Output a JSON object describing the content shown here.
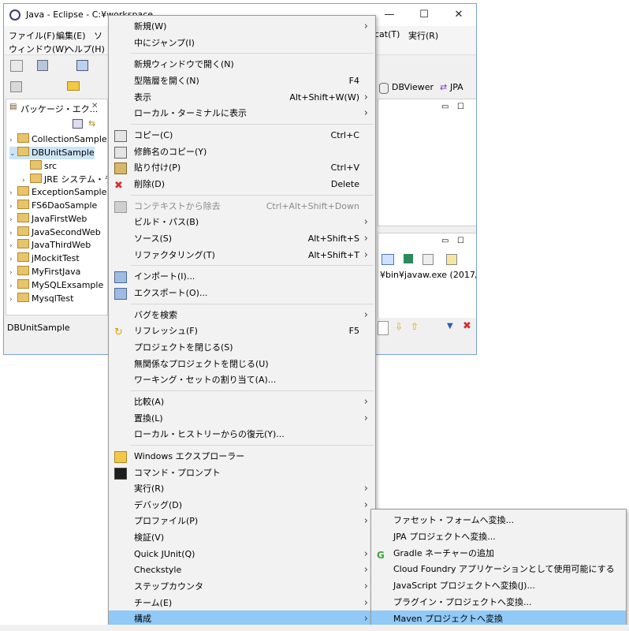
{
  "window": {
    "title": "Java - Eclipse - C:¥workspace",
    "controls": [
      "—",
      "☐",
      "✕"
    ],
    "menubar": [
      "ファイル(F)",
      "編集(E)",
      "ソ",
      "ウィンドウ(W)",
      "ヘルプ(H)",
      "cat(T)",
      "実行(R)"
    ],
    "toolbar_right": [
      "DBViewer",
      "JPA"
    ],
    "explorer_tab": "パッケージ・エク...",
    "tree": [
      {
        "label": "CollectionSample",
        "indent": 0,
        "twisty": ">"
      },
      {
        "label": "DBUnitSample",
        "indent": 0,
        "twisty": "v",
        "selected": true
      },
      {
        "label": "src",
        "indent": 1,
        "twisty": ""
      },
      {
        "label": "JRE システム・ラ",
        "indent": 1,
        "twisty": ">"
      },
      {
        "label": "ExceptionSample",
        "indent": 0,
        "twisty": ">"
      },
      {
        "label": "FS6DaoSample",
        "indent": 0,
        "twisty": ">"
      },
      {
        "label": "JavaFirstWeb",
        "indent": 0,
        "twisty": ">"
      },
      {
        "label": "JavaSecondWeb",
        "indent": 0,
        "twisty": ">"
      },
      {
        "label": "JavaThirdWeb",
        "indent": 0,
        "twisty": ">"
      },
      {
        "label": "jMockitTest",
        "indent": 0,
        "twisty": ">"
      },
      {
        "label": "MyFirstJava",
        "indent": 0,
        "twisty": ">"
      },
      {
        "label": "MySQLExsample",
        "indent": 0,
        "twisty": ">"
      },
      {
        "label": "MysqlTest",
        "indent": 0,
        "twisty": ">"
      }
    ],
    "console_path": "¥bin¥javaw.exe (2017/07/",
    "status_text": "DBUnitSample"
  },
  "context_menu": {
    "items": [
      {
        "label": "新規(W)",
        "shortcut": "",
        "submenu": true,
        "icon": ""
      },
      {
        "label": "中にジャンプ(I)",
        "shortcut": "",
        "submenu": false,
        "icon": ""
      },
      {
        "sep": true
      },
      {
        "label": "新規ウィンドウで開く(N)",
        "shortcut": "",
        "submenu": false,
        "icon": ""
      },
      {
        "label": "型階層を開く(N)",
        "shortcut": "F4",
        "submenu": false,
        "icon": ""
      },
      {
        "label": "表示",
        "shortcut": "Alt+Shift+W(W)",
        "submenu": true,
        "icon": ""
      },
      {
        "label": "ローカル・ターミナルに表示",
        "shortcut": "",
        "submenu": true,
        "icon": ""
      },
      {
        "sep": true
      },
      {
        "label": "コピー(C)",
        "shortcut": "Ctrl+C",
        "submenu": false,
        "icon": "copy-icon"
      },
      {
        "label": "修飾名のコピー(Y)",
        "shortcut": "",
        "submenu": false,
        "icon": "copy-qualified-icon"
      },
      {
        "label": "貼り付け(P)",
        "shortcut": "Ctrl+V",
        "submenu": false,
        "icon": "paste-icon"
      },
      {
        "label": "削除(D)",
        "shortcut": "Delete",
        "submenu": false,
        "icon": "delete-icon"
      },
      {
        "sep": true
      },
      {
        "label": "コンテキストから除去",
        "shortcut": "Ctrl+Alt+Shift+Down",
        "submenu": false,
        "icon": "remove-context-icon",
        "disabled": true
      },
      {
        "label": "ビルド・パス(B)",
        "shortcut": "",
        "submenu": true,
        "icon": ""
      },
      {
        "label": "ソース(S)",
        "shortcut": "Alt+Shift+S",
        "submenu": true,
        "icon": ""
      },
      {
        "label": "リファクタリング(T)",
        "shortcut": "Alt+Shift+T",
        "submenu": true,
        "icon": ""
      },
      {
        "sep": true
      },
      {
        "label": "インポート(I)...",
        "shortcut": "",
        "submenu": false,
        "icon": "import-icon"
      },
      {
        "label": "エクスポート(O)...",
        "shortcut": "",
        "submenu": false,
        "icon": "export-icon"
      },
      {
        "sep": true
      },
      {
        "label": "バグを検索",
        "shortcut": "",
        "submenu": true,
        "icon": ""
      },
      {
        "label": "リフレッシュ(F)",
        "shortcut": "F5",
        "submenu": false,
        "icon": "refresh-icon"
      },
      {
        "label": "プロジェクトを閉じる(S)",
        "shortcut": "",
        "submenu": false,
        "icon": ""
      },
      {
        "label": "無関係なプロジェクトを閉じる(U)",
        "shortcut": "",
        "submenu": false,
        "icon": ""
      },
      {
        "label": "ワーキング・セットの割り当て(A)...",
        "shortcut": "",
        "submenu": false,
        "icon": ""
      },
      {
        "sep": true
      },
      {
        "label": "比較(A)",
        "shortcut": "",
        "submenu": true,
        "icon": ""
      },
      {
        "label": "置換(L)",
        "shortcut": "",
        "submenu": true,
        "icon": ""
      },
      {
        "label": "ローカル・ヒストリーからの復元(Y)...",
        "shortcut": "",
        "submenu": false,
        "icon": ""
      },
      {
        "sep": true
      },
      {
        "label": "Windows エクスプローラー",
        "shortcut": "",
        "submenu": false,
        "icon": "explorer-icon"
      },
      {
        "label": "コマンド・プロンプト",
        "shortcut": "",
        "submenu": false,
        "icon": "command-prompt-icon"
      },
      {
        "label": "実行(R)",
        "shortcut": "",
        "submenu": true,
        "icon": ""
      },
      {
        "label": "デバッグ(D)",
        "shortcut": "",
        "submenu": true,
        "icon": ""
      },
      {
        "label": "プロファイル(P)",
        "shortcut": "",
        "submenu": true,
        "icon": ""
      },
      {
        "label": "検証(V)",
        "shortcut": "",
        "submenu": false,
        "icon": ""
      },
      {
        "label": "Quick JUnit(Q)",
        "shortcut": "",
        "submenu": true,
        "icon": ""
      },
      {
        "label": "Checkstyle",
        "shortcut": "",
        "submenu": true,
        "icon": ""
      },
      {
        "label": "ステップカウンタ",
        "shortcut": "",
        "submenu": true,
        "icon": ""
      },
      {
        "label": "チーム(E)",
        "shortcut": "",
        "submenu": true,
        "icon": ""
      },
      {
        "label": "構成",
        "shortcut": "",
        "submenu": true,
        "icon": "",
        "highlighted": true
      }
    ]
  },
  "submenu": {
    "items": [
      {
        "label": "ファセット・フォームへ変換...",
        "icon": ""
      },
      {
        "label": "JPA プロジェクトへ変換...",
        "icon": ""
      },
      {
        "label": "Gradle ネーチャーの追加",
        "icon": "gradle-icon"
      },
      {
        "label": "Cloud Foundry アプリケーションとして使用可能にする",
        "icon": ""
      },
      {
        "label": "JavaScript プロジェクトへ変換(J)...",
        "icon": ""
      },
      {
        "label": "プラグイン・プロジェクトへ変換...",
        "icon": ""
      },
      {
        "label": "Maven プロジェクトへ変換",
        "icon": "",
        "highlighted": true
      }
    ]
  },
  "colors": {
    "highlight": "#91c9f7",
    "selection": "#cce4f7",
    "delete": "#d32f2f",
    "gradle": "#3aa83a"
  }
}
